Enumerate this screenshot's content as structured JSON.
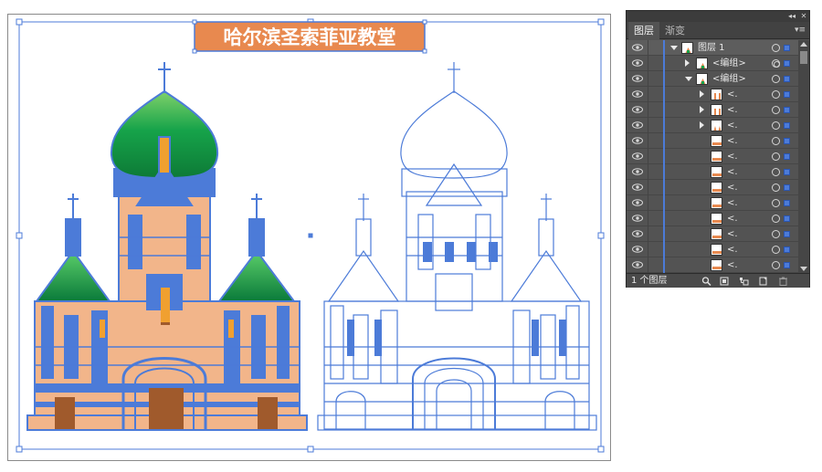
{
  "artboard": {
    "title": "哈尔滨圣索菲亚教堂",
    "title_bg": "#e8894f",
    "title_border": "#4c7bd8",
    "path_color": "#4c7bd8",
    "fill_peach": "#f2b58a",
    "fill_green_top": "#0f8f3c",
    "fill_green_bottom": "#7fd16a",
    "fill_brown": "#a05a2c"
  },
  "layers_panel": {
    "tabs": [
      {
        "label": "图层",
        "active": true
      },
      {
        "label": "渐变",
        "active": false
      }
    ],
    "rows": [
      {
        "indent": 0,
        "expand": "down",
        "thumb": "layer",
        "label": "图层 1",
        "target": "single"
      },
      {
        "indent": 1,
        "expand": "right",
        "thumb": "church-color",
        "label": "<编组>",
        "target": "double"
      },
      {
        "indent": 1,
        "expand": "down",
        "thumb": "church-color",
        "label": "<编组>",
        "target": "single"
      },
      {
        "indent": 2,
        "expand": "right",
        "thumb": "strip",
        "label": "<.",
        "target": "single"
      },
      {
        "indent": 2,
        "expand": "right",
        "thumb": "strip",
        "label": "<.",
        "target": "single"
      },
      {
        "indent": 2,
        "expand": "right",
        "thumb": "dome",
        "label": "<.",
        "target": "single"
      },
      {
        "indent": 2,
        "expand": "none",
        "thumb": "bar",
        "label": "<.",
        "target": "single"
      },
      {
        "indent": 2,
        "expand": "none",
        "thumb": "bar",
        "label": "<.",
        "target": "single"
      },
      {
        "indent": 2,
        "expand": "none",
        "thumb": "bar",
        "label": "<.",
        "target": "single"
      },
      {
        "indent": 2,
        "expand": "none",
        "thumb": "bar",
        "label": "<.",
        "target": "single"
      },
      {
        "indent": 2,
        "expand": "none",
        "thumb": "bar",
        "label": "<.",
        "target": "single"
      },
      {
        "indent": 2,
        "expand": "none",
        "thumb": "bar",
        "label": "<.",
        "target": "single"
      },
      {
        "indent": 2,
        "expand": "none",
        "thumb": "bar",
        "label": "<.",
        "target": "single"
      },
      {
        "indent": 2,
        "expand": "none",
        "thumb": "bar",
        "label": "<.",
        "target": "single"
      },
      {
        "indent": 2,
        "expand": "none",
        "thumb": "bar",
        "label": "<.",
        "target": "single"
      }
    ],
    "footer": {
      "layer_count": "1 个图层"
    },
    "icons": [
      "eye-icon",
      "locate-object-icon",
      "make-clipping-mask-icon",
      "new-sublayer-icon",
      "new-layer-icon",
      "delete-icon",
      "panel-menu-icon",
      "collapse-icon",
      "close-icon"
    ]
  }
}
